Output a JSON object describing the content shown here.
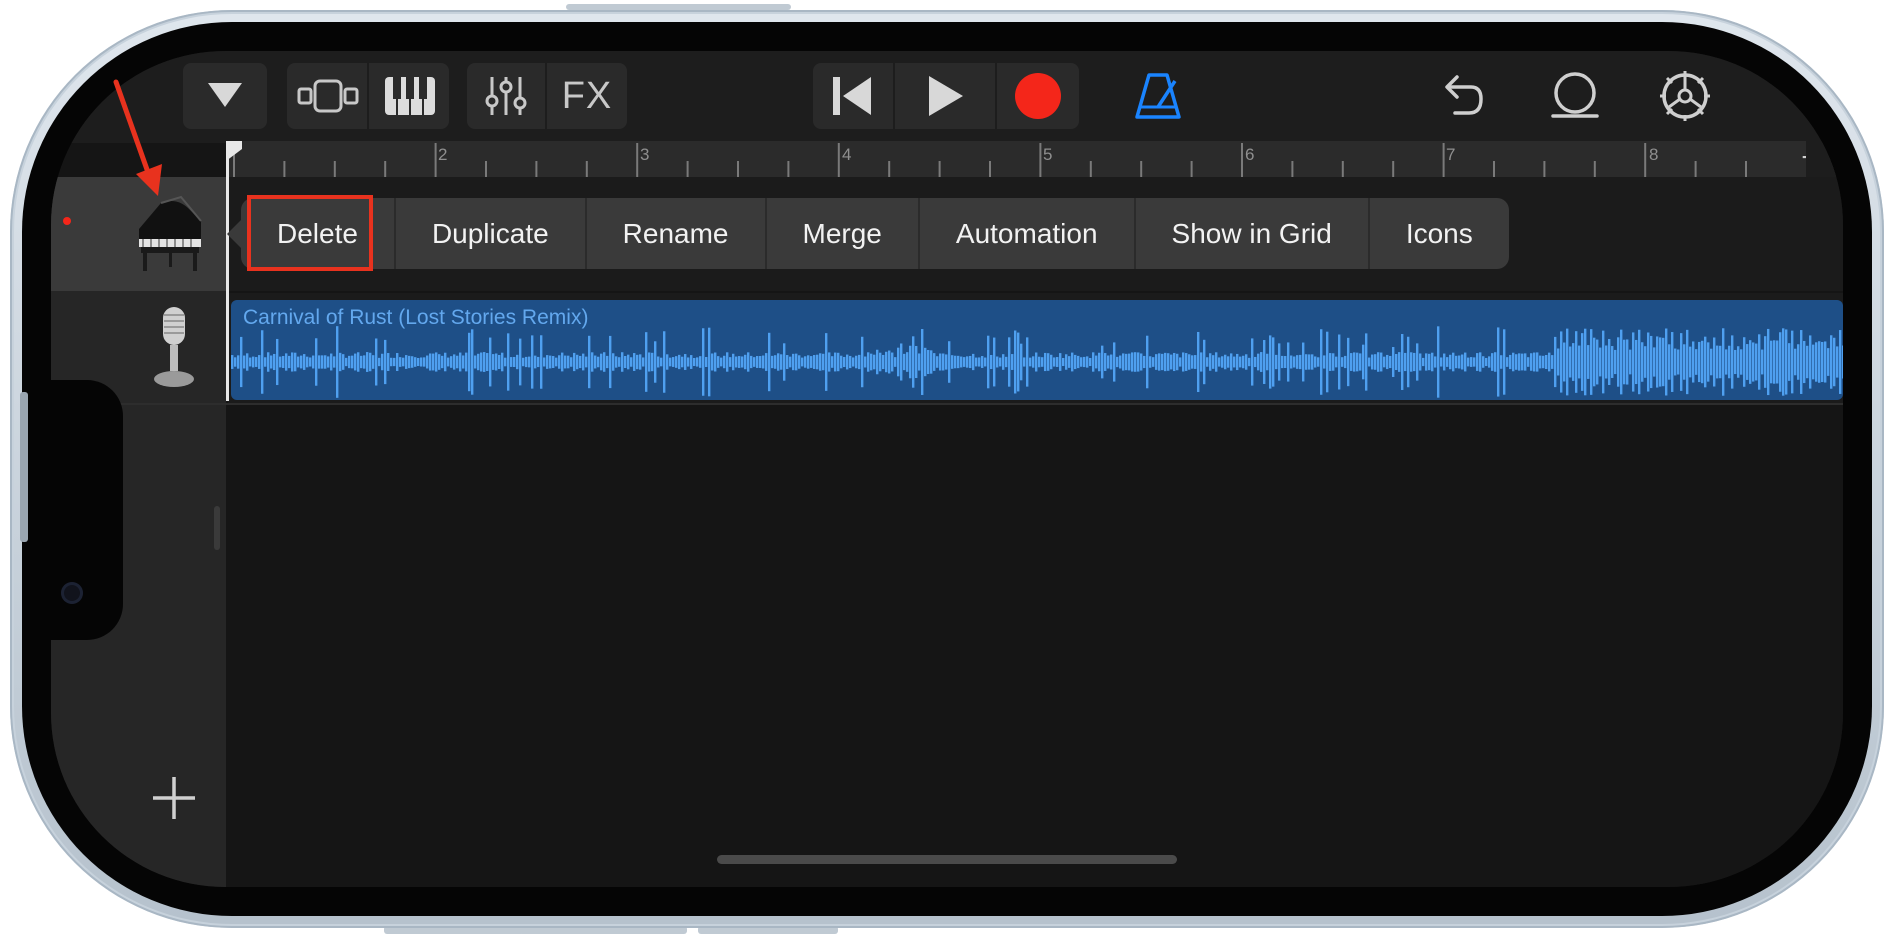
{
  "toolbar": {
    "tracks_menu": "tracks-dropdown",
    "fx_label": "FX"
  },
  "ruler": {
    "bars": [
      "2",
      "3",
      "4",
      "5",
      "6",
      "7",
      "8"
    ],
    "add_label": "+"
  },
  "popup_menu": {
    "items": [
      "Delete",
      "Duplicate",
      "Rename",
      "Merge",
      "Automation",
      "Show in Grid",
      "Icons"
    ],
    "highlighted": "Delete"
  },
  "tracks": [
    {
      "instrument": "grand-piano"
    },
    {
      "instrument": "microphone"
    }
  ],
  "region": {
    "title": "Carnival of Rust (Lost Stories Remix)",
    "color": "#1e4f87",
    "waveform_color": "#4fa0f0"
  },
  "sidebar": {
    "add_track_label": "+"
  },
  "colors": {
    "record": "#f4261a",
    "metronome": "#1a84ff",
    "annotation": "#e8321e"
  }
}
